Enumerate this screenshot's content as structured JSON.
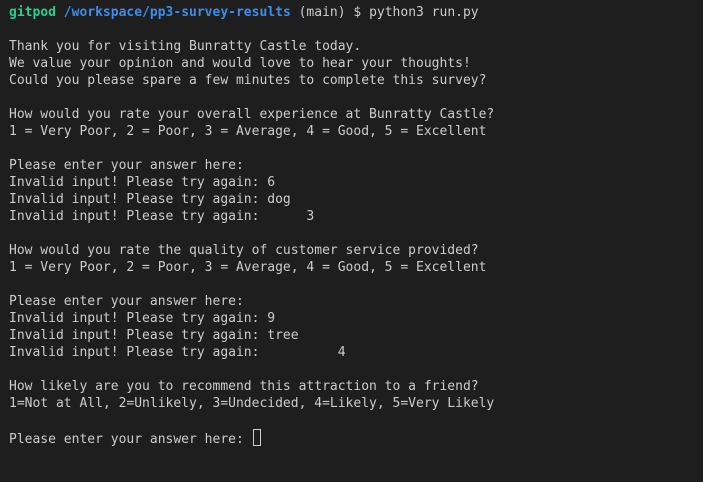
{
  "prompt": {
    "user": "gitpod",
    "path": "/workspace/pp3-survey-results",
    "branch": "(main)",
    "symbol": "$",
    "command": "python3 run.py"
  },
  "lines": [
    "",
    "Thank you for visiting Bunratty Castle today.",
    "We value your opinion and would love to hear your thoughts!",
    "Could you please spare a few minutes to complete this survey?",
    "",
    "How would you rate your overall experience at Bunratty Castle?",
    "1 = Very Poor, 2 = Poor, 3 = Average, 4 = Good, 5 = Excellent",
    "",
    "Please enter your answer here:",
    "Invalid input! Please try again: 6",
    "Invalid input! Please try again: dog",
    "Invalid input! Please try again:      3",
    "",
    "How would you rate the quality of customer service provided?",
    "1 = Very Poor, 2 = Poor, 3 = Average, 4 = Good, 5 = Excellent",
    "",
    "Please enter your answer here:",
    "Invalid input! Please try again: 9",
    "Invalid input! Please try again: tree",
    "Invalid input! Please try again:          4",
    "",
    "How likely are you to recommend this attraction to a friend?",
    "1=Not at All, 2=Unlikely, 3=Undecided, 4=Likely, 5=Very Likely",
    ""
  ],
  "current_input": {
    "prompt": "Please enter your answer here: ",
    "value": ""
  }
}
